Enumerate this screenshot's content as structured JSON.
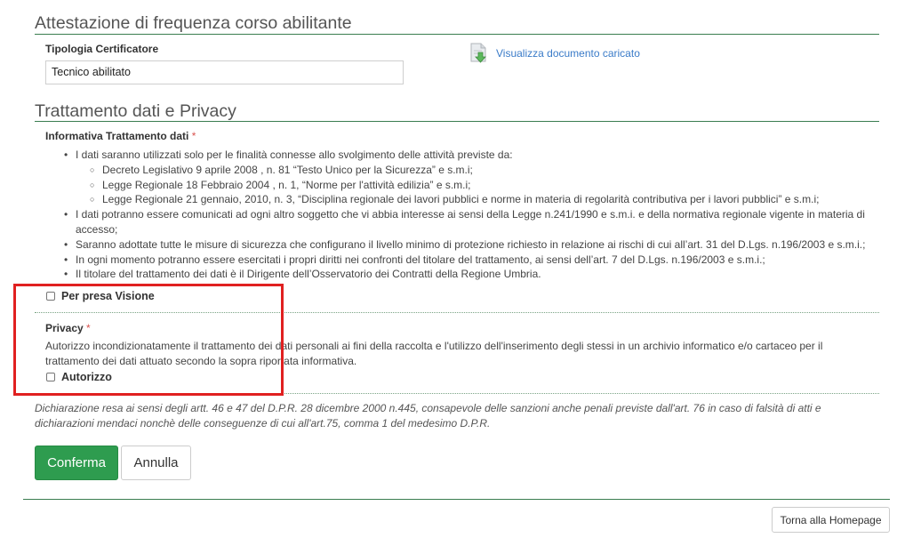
{
  "attestazione": {
    "title": "Attestazione di frequenza corso abilitante",
    "tipologia_label": "Tipologia Certificatore",
    "tipologia_value": "Tecnico abilitato",
    "document_link": "Visualizza documento caricato",
    "document_icon": "document-download-icon"
  },
  "privacy_section": {
    "title": "Trattamento dati e Privacy",
    "informativa_label": "Informativa Trattamento dati",
    "required_mark": "*",
    "items": [
      {
        "text": "I dati saranno utilizzati solo per le finalità connesse allo svolgimento delle attività previste da:",
        "subitems": [
          "Decreto Legislativo 9 aprile 2008 , n. 81 “Testo Unico per la Sicurezza” e s.m.i;",
          "Legge Regionale 18 Febbraio 2004 , n. 1, “Norme per l'attività edilizia” e s.m.i;",
          "Legge Regionale 21 gennaio, 2010, n. 3, “Disciplina regionale dei lavori pubblici e norme in materia di regolarità contributiva per i lavori pubblici” e s.m.i;"
        ]
      },
      {
        "text": "I dati potranno essere comunicati ad ogni altro soggetto che vi abbia interesse ai sensi della Legge n.241/1990 e s.m.i. e della normativa regionale vigente in materia di accesso;"
      },
      {
        "text": "Saranno adottate tutte le misure di sicurezza che configurano il livello minimo di protezione richiesto in relazione ai rischi di cui all’art. 31 del D.Lgs. n.196/2003 e s.m.i.;"
      },
      {
        "text": "In ogni momento potranno essere esercitati i propri diritti nei confronti del titolare del trattamento, ai sensi dell’art. 7 del D.Lgs. n.196/2003 e s.m.i.;"
      },
      {
        "text": "Il titolare del trattamento dei dati è il Dirigente dell’Osservatorio dei Contratti della Regione Umbria."
      }
    ],
    "presa_visione_label": "Per presa Visione",
    "privacy_label": "Privacy",
    "privacy_text": "Autorizzo incondizionatamente il trattamento dei dati personali ai fini della raccolta e l'utilizzo dell'inserimento degli stessi in un archivio informatico e/o cartaceo per il trattamento dei dati attuato secondo la sopra riportata informativa.",
    "autorizzo_label": "Autorizzo"
  },
  "declaration": "Dichiarazione resa ai sensi degli artt. 46 e 47 del D.P.R. 28 dicembre 2000 n.445, consapevole delle sanzioni anche penali previste dall'art. 76 in caso di falsità di atti e dichiarazioni mendaci nonchè delle conseguenze di cui all'art.75, comma 1 del medesimo D.P.R.",
  "actions": {
    "confirm_label": "Conferma",
    "cancel_label": "Annulla",
    "home_label": "Torna alla Homepage"
  },
  "colors": {
    "accent_green": "#2e9c4f",
    "rule_green": "#3a7d50",
    "link_blue": "#3a7bc8",
    "required_red": "#d9534f",
    "highlight_red": "#e02020"
  }
}
